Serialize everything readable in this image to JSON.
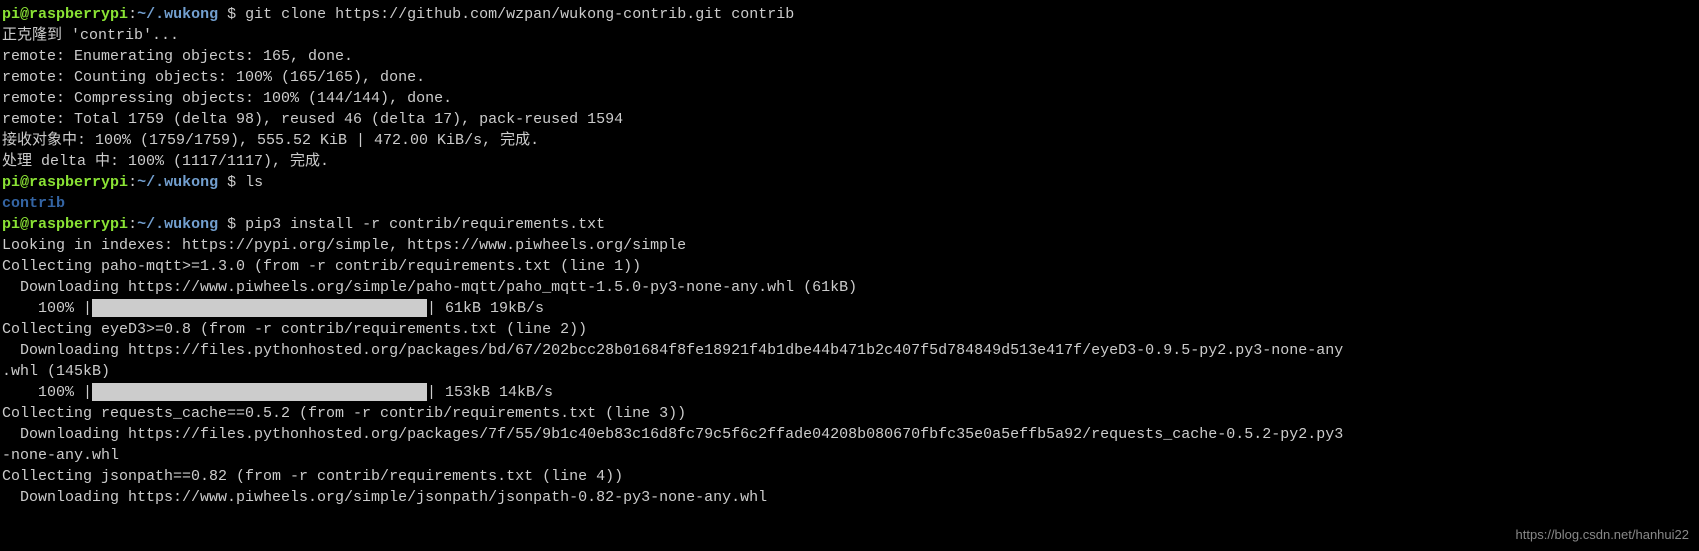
{
  "prompt": {
    "user": "pi",
    "host": "raspberrypi",
    "path": "~/.wukong",
    "symbol": " $"
  },
  "cmd1": "git clone https://github.com/wzpan/wukong-contrib.git contrib",
  "out1": {
    "l1": "正克隆到 'contrib'...",
    "l2": "remote: Enumerating objects: 165, done.",
    "l3": "remote: Counting objects: 100% (165/165), done.",
    "l4": "remote: Compressing objects: 100% (144/144), done.",
    "l5": "remote: Total 1759 (delta 98), reused 46 (delta 17), pack-reused 1594",
    "l6": "接收对象中: 100% (1759/1759), 555.52 KiB | 472.00 KiB/s, 完成.",
    "l7": "处理 delta 中: 100% (1117/1117), 完成."
  },
  "cmd2": "ls",
  "out2": "contrib",
  "cmd3": "pip3 install -r contrib/requirements.txt",
  "out3": {
    "l1": "Looking in indexes: https://pypi.org/simple, https://www.piwheels.org/simple",
    "l2": "Collecting paho-mqtt>=1.3.0 (from -r contrib/requirements.txt (line 1))",
    "l3": "  Downloading https://www.piwheels.org/simple/paho-mqtt/paho_mqtt-1.5.0-py3-none-any.whl (61kB)",
    "l4a": "    100% |",
    "l4b": "| 61kB 19kB/s",
    "l5": "Collecting eyeD3>=0.8 (from -r contrib/requirements.txt (line 2))",
    "l6": "  Downloading https://files.pythonhosted.org/packages/bd/67/202bcc28b01684f8fe18921f4b1dbe44b471b2c407f5d784849d513e417f/eyeD3-0.9.5-py2.py3-none-any",
    "l7": ".whl (145kB)",
    "l8a": "    100% |",
    "l8b": "| 153kB 14kB/s",
    "l9": "Collecting requests_cache==0.5.2 (from -r contrib/requirements.txt (line 3))",
    "l10": "  Downloading https://files.pythonhosted.org/packages/7f/55/9b1c40eb83c16d8fc79c5f6c2ffade04208b080670fbfc35e0a5effb5a92/requests_cache-0.5.2-py2.py3",
    "l11": "-none-any.whl",
    "l12": "Collecting jsonpath==0.82 (from -r contrib/requirements.txt (line 4))",
    "l13": "  Downloading https://www.piwheels.org/simple/jsonpath/jsonpath-0.82-py3-none-any.whl"
  },
  "watermark": "https://blog.csdn.net/hanhui22"
}
